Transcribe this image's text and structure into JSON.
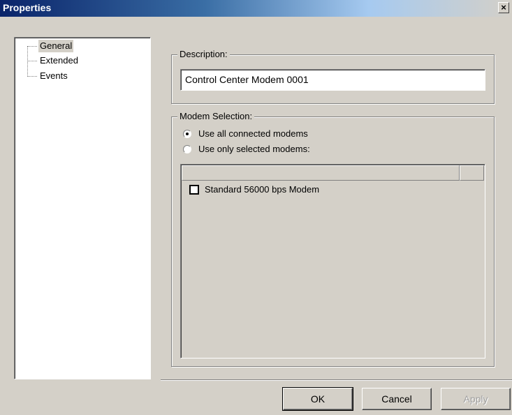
{
  "window": {
    "title": "Properties",
    "close_glyph": "×"
  },
  "tree": {
    "items": [
      {
        "label": "General",
        "selected": true
      },
      {
        "label": "Extended",
        "selected": false
      },
      {
        "label": "Events",
        "selected": false
      }
    ]
  },
  "description": {
    "legend": "Description:",
    "value": "Control Center Modem 0001"
  },
  "modem_selection": {
    "legend": "Modem Selection:",
    "options": [
      {
        "label": "Use all connected modems",
        "selected": true
      },
      {
        "label": "Use only selected modems:",
        "selected": false
      }
    ],
    "modems": [
      {
        "label": "Standard 56000 bps Modem",
        "checked": false
      }
    ]
  },
  "buttons": {
    "ok": "OK",
    "cancel": "Cancel",
    "apply": "Apply"
  },
  "colors": {
    "titlebar_start": "#0a246a",
    "titlebar_end": "#a6caf0",
    "face": "#d4d0c8"
  }
}
